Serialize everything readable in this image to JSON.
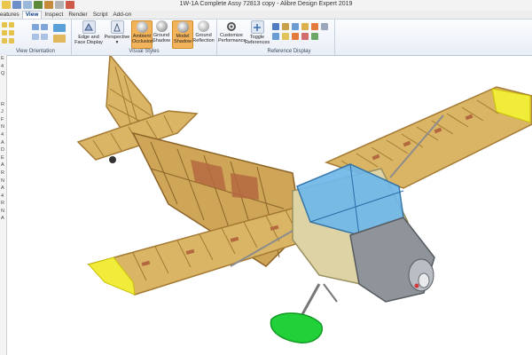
{
  "window": {
    "title": "1W-1A Complete Assy 72813 copy - Alibre Design Expert 2019"
  },
  "tabs": [
    {
      "label": "eatures"
    },
    {
      "label": "View",
      "active": true
    },
    {
      "label": "Inspect"
    },
    {
      "label": "Render"
    },
    {
      "label": "Script"
    },
    {
      "label": "Add-on"
    }
  ],
  "ribbon": {
    "groups": {
      "view_orientation": "View Orientation",
      "visual_styles": "Visual Styles",
      "reference_display": "Reference Display"
    },
    "buttons": {
      "edge_face_line1": "Edge and",
      "edge_face_line2": "Face Display",
      "perspective": "Perspective",
      "ambient_line1": "Ambient",
      "ambient_line2": "Occlusion",
      "ground_shadow_line1": "Ground",
      "ground_shadow_line2": "Shadow",
      "model_shadow_line1": "Model",
      "model_shadow_line2": "Shadow",
      "ground_reflection_line1": "Ground",
      "ground_reflection_line2": "Reflection",
      "customize_line1": "Customize",
      "customize_line2": "Performance",
      "toggle_line1": "Toggle",
      "toggle_line2": "References"
    }
  },
  "left_strip": {
    "items": [
      "E",
      "4",
      "Q",
      "",
      "",
      "",
      "R",
      "J",
      "F",
      "N",
      "4",
      "A",
      "D",
      "E",
      "A",
      "R",
      "N",
      "A",
      "4",
      "R",
      "N",
      "A"
    ]
  },
  "colors": {
    "wood": "#d9b565",
    "wood_dark": "#a47a34",
    "rib": "#b4683f",
    "wing_tip": "#f1ec3a",
    "canopy": "#6fb8ea",
    "cowl": "#8e949a",
    "wheel": "#22d13a",
    "active_button": "#f2b35a"
  }
}
